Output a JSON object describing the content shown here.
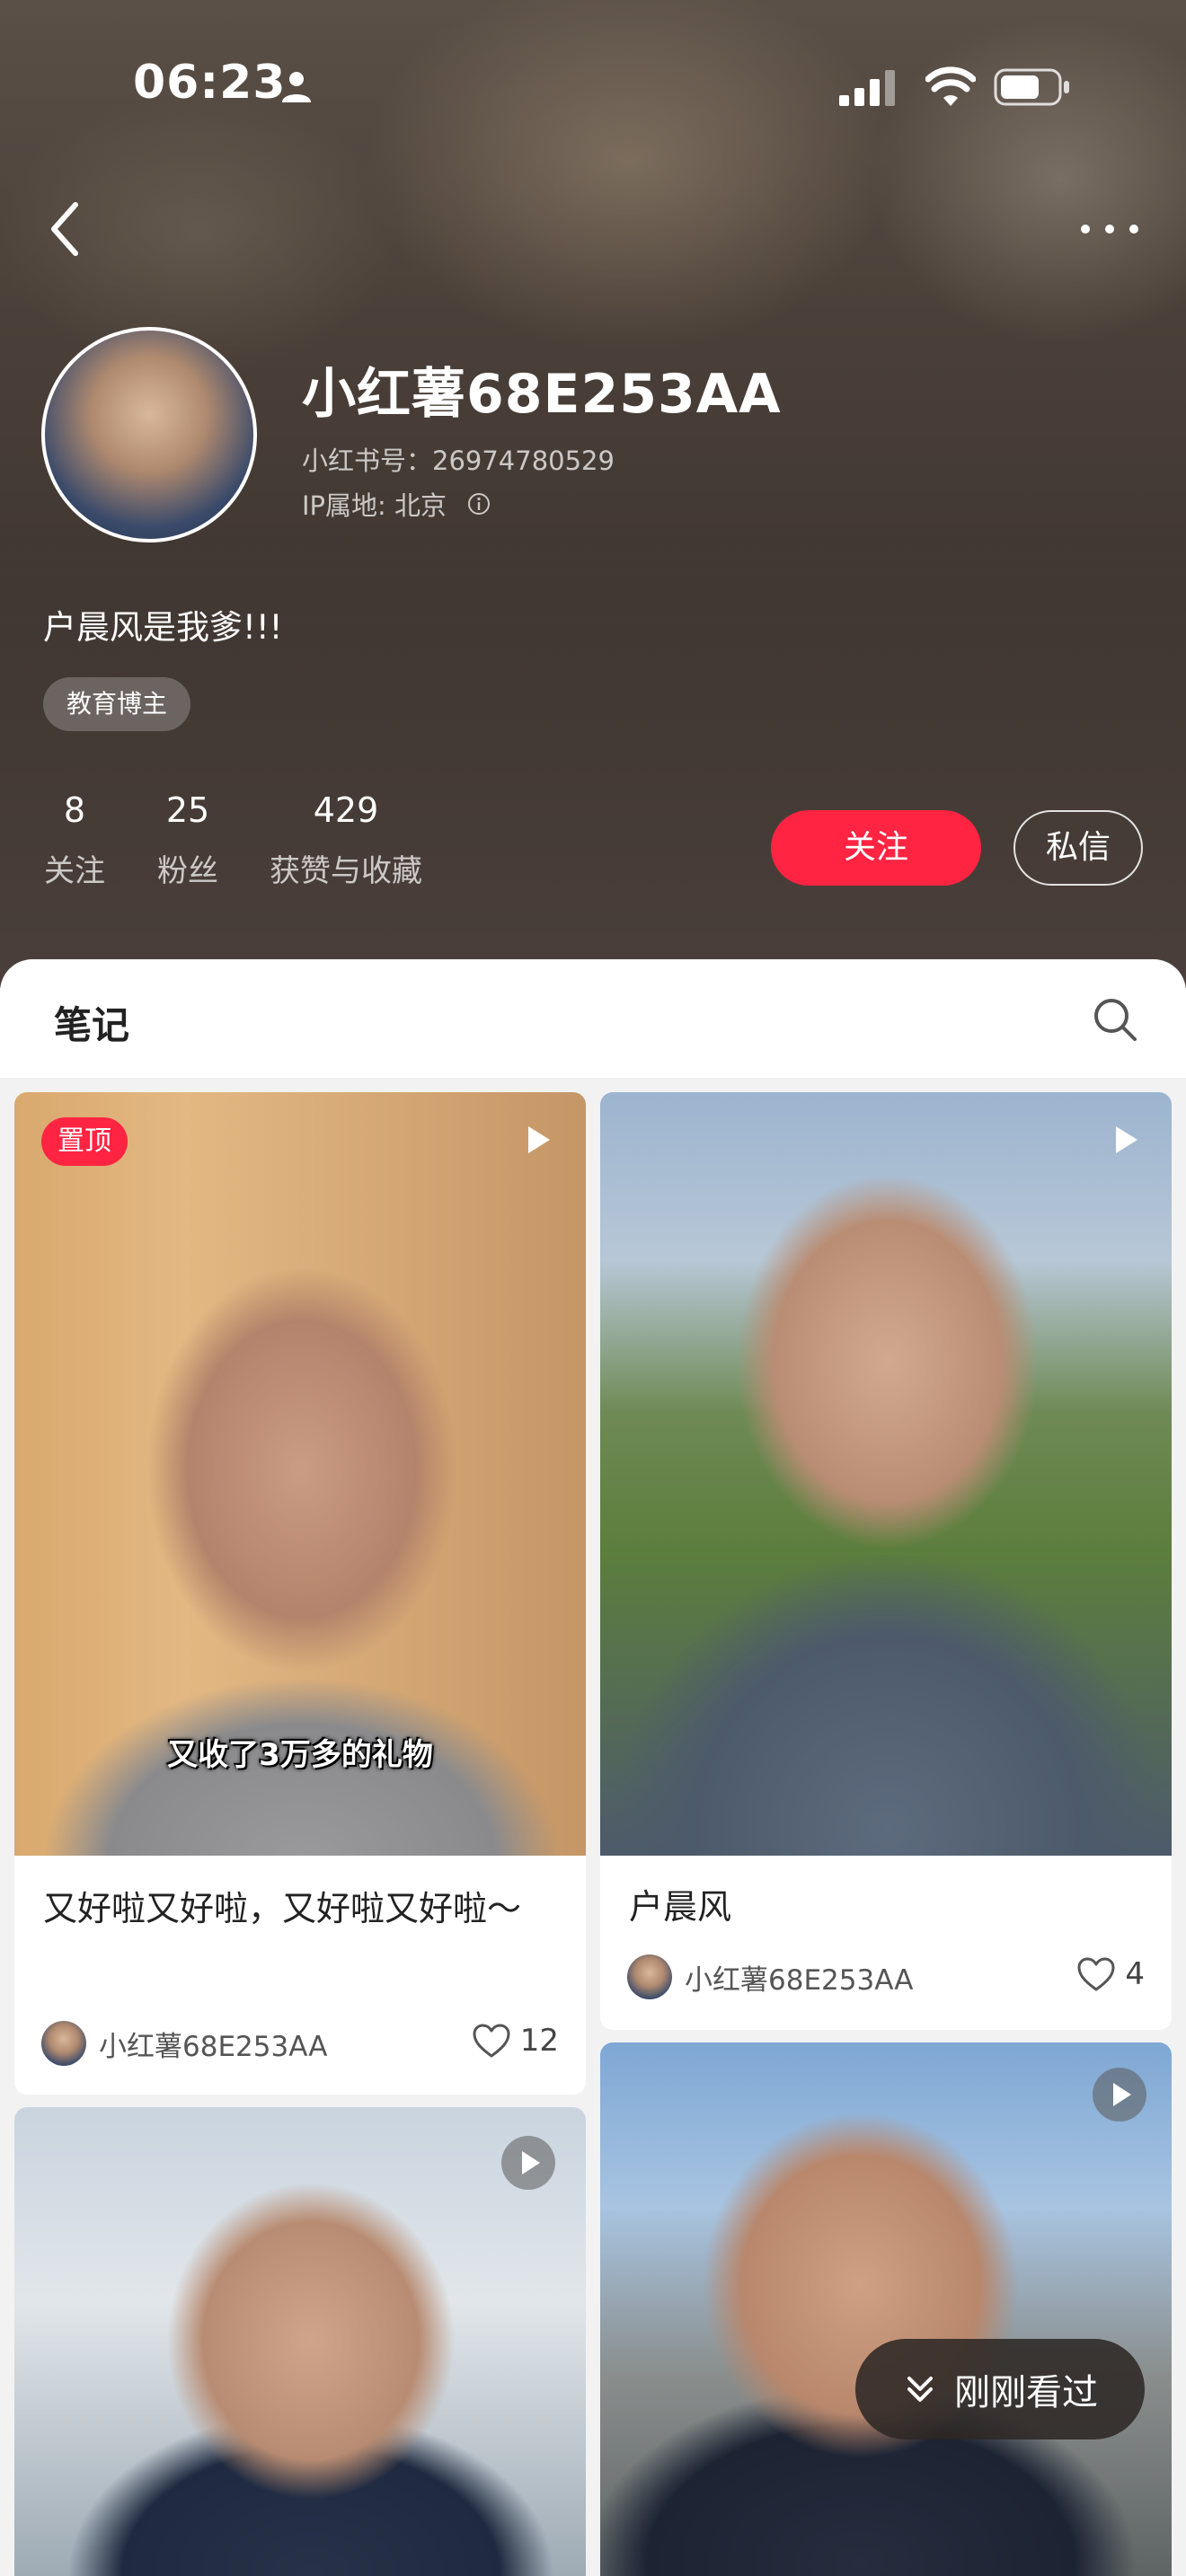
{
  "status_bar": {
    "time": "06:23",
    "icons": [
      "person-icon",
      "signal-icon",
      "wifi-icon",
      "battery-icon"
    ]
  },
  "nav": {
    "back_icon": "chevron-left-icon",
    "more_icon": "more-icon"
  },
  "profile": {
    "username": "小红薯68E253AA",
    "redbook_id": "小红书号：26974780529",
    "ip_location": "IP属地: 北京",
    "bio": "户晨风是我爹!!!",
    "tag": "教育博主",
    "stats": [
      {
        "number": "8",
        "label": "关注"
      },
      {
        "number": "25",
        "label": "粉丝"
      },
      {
        "number": "429",
        "label": "获赞与收藏"
      }
    ],
    "follow_label": "关注",
    "message_label": "私信"
  },
  "tabs": {
    "notes_label": "笔记",
    "search_icon": "search-icon"
  },
  "notes": [
    {
      "pinned_label": "置顶",
      "video_caption": "又收了3万多的礼物",
      "title": "又好啦又好啦，又好啦又好啦～",
      "author": "小红薯68E253AA",
      "likes": "12"
    },
    {
      "title": "户晨风",
      "author": "小红薯68E253AA",
      "likes": "4"
    },
    {},
    {}
  ],
  "recent_pill": {
    "label": "刚刚看过",
    "icon": "double-chevron-down-icon"
  },
  "colors": {
    "accent": "#ff2442",
    "header_bg": "#4a3f3a"
  }
}
